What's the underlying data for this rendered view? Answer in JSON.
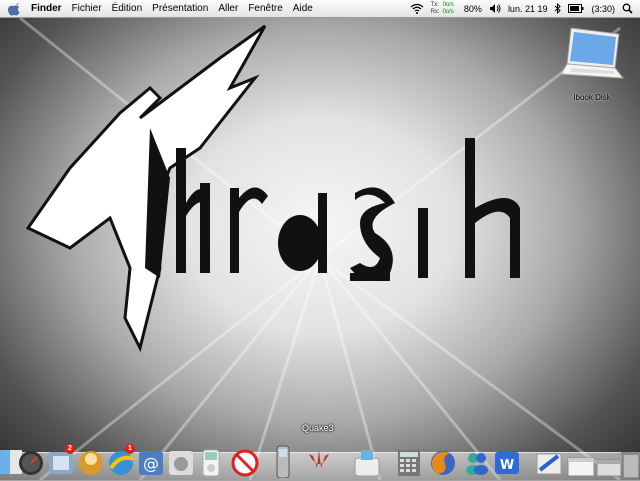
{
  "menubar": {
    "app": "Finder",
    "items": [
      "Fichier",
      "Édition",
      "Présentation",
      "Aller",
      "Fenêtre",
      "Aide"
    ],
    "net": {
      "tx_label": "Tx:",
      "rx_label": "Rx:",
      "tx_value": "0o/s",
      "rx_value": "0o/s"
    },
    "battery": "80%",
    "clock": "lun. 21 19",
    "battery_time": "(3:30)"
  },
  "desktop": {
    "wallpaper_text": "Thrash",
    "icons": [
      {
        "label": "Ibook Disk",
        "icon": "laptop-icon"
      }
    ]
  },
  "dock": {
    "tooltip": "Quake3",
    "items": [
      {
        "icon": "finder-icon"
      },
      {
        "icon": "dashboard-icon"
      },
      {
        "icon": "mail-icon",
        "badge": "2"
      },
      {
        "icon": "aqua-orb-icon"
      },
      {
        "icon": "ical-icon",
        "badge": "1"
      },
      {
        "icon": "address-at-icon"
      },
      {
        "icon": "apple-icon"
      },
      {
        "icon": "ipod-icon"
      },
      {
        "icon": "no-entry-icon"
      },
      {
        "icon": "phone-icon"
      },
      {
        "icon": "quake3-icon"
      },
      {
        "icon": "toaster-icon"
      },
      {
        "icon": "calculator-icon"
      },
      {
        "icon": "firefox-icon"
      },
      {
        "icon": "msn-icon"
      },
      {
        "icon": "word-icon"
      },
      {
        "icon": "utility-icon"
      },
      {
        "icon": "window-icon"
      },
      {
        "icon": "minimized-window-icon"
      },
      {
        "icon": "trash-icon"
      }
    ]
  }
}
